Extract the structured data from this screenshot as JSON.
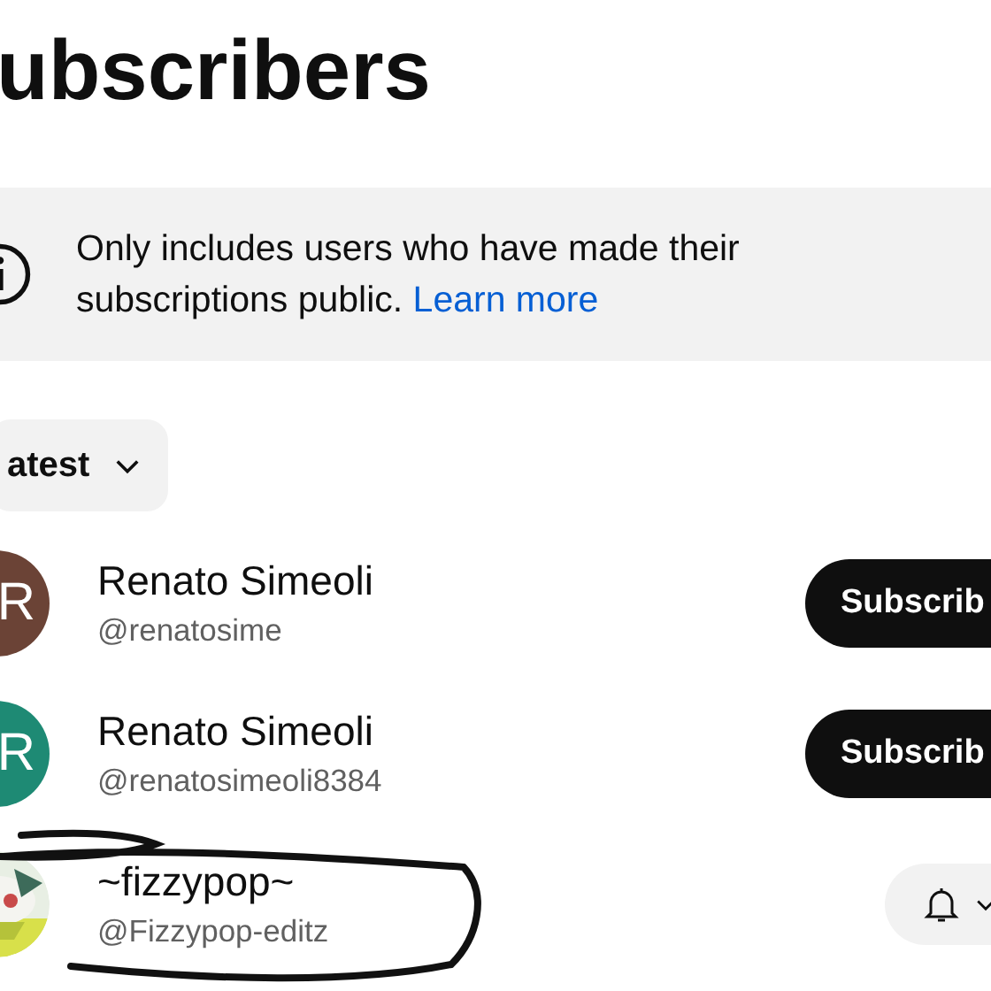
{
  "title": "ubscribers",
  "notice": {
    "text": "Only includes users who have made their subscriptions public.",
    "link": "Learn more"
  },
  "sort": {
    "label": "atest"
  },
  "subscribers": [
    {
      "initial": "R",
      "color": "#6b4336",
      "name": "Renato Simeoli",
      "handle": "@renatosime",
      "subscribed": false,
      "button": "Subscrib"
    },
    {
      "initial": "R",
      "color": "#1e8a74",
      "name": "Renato Simeoli",
      "handle": "@renatosimeoli8384",
      "subscribed": false,
      "button": "Subscrib"
    },
    {
      "kind": "picture",
      "name": "~fizzypop~",
      "handle": "@Fizzypop-editz",
      "subscribed": true
    }
  ]
}
